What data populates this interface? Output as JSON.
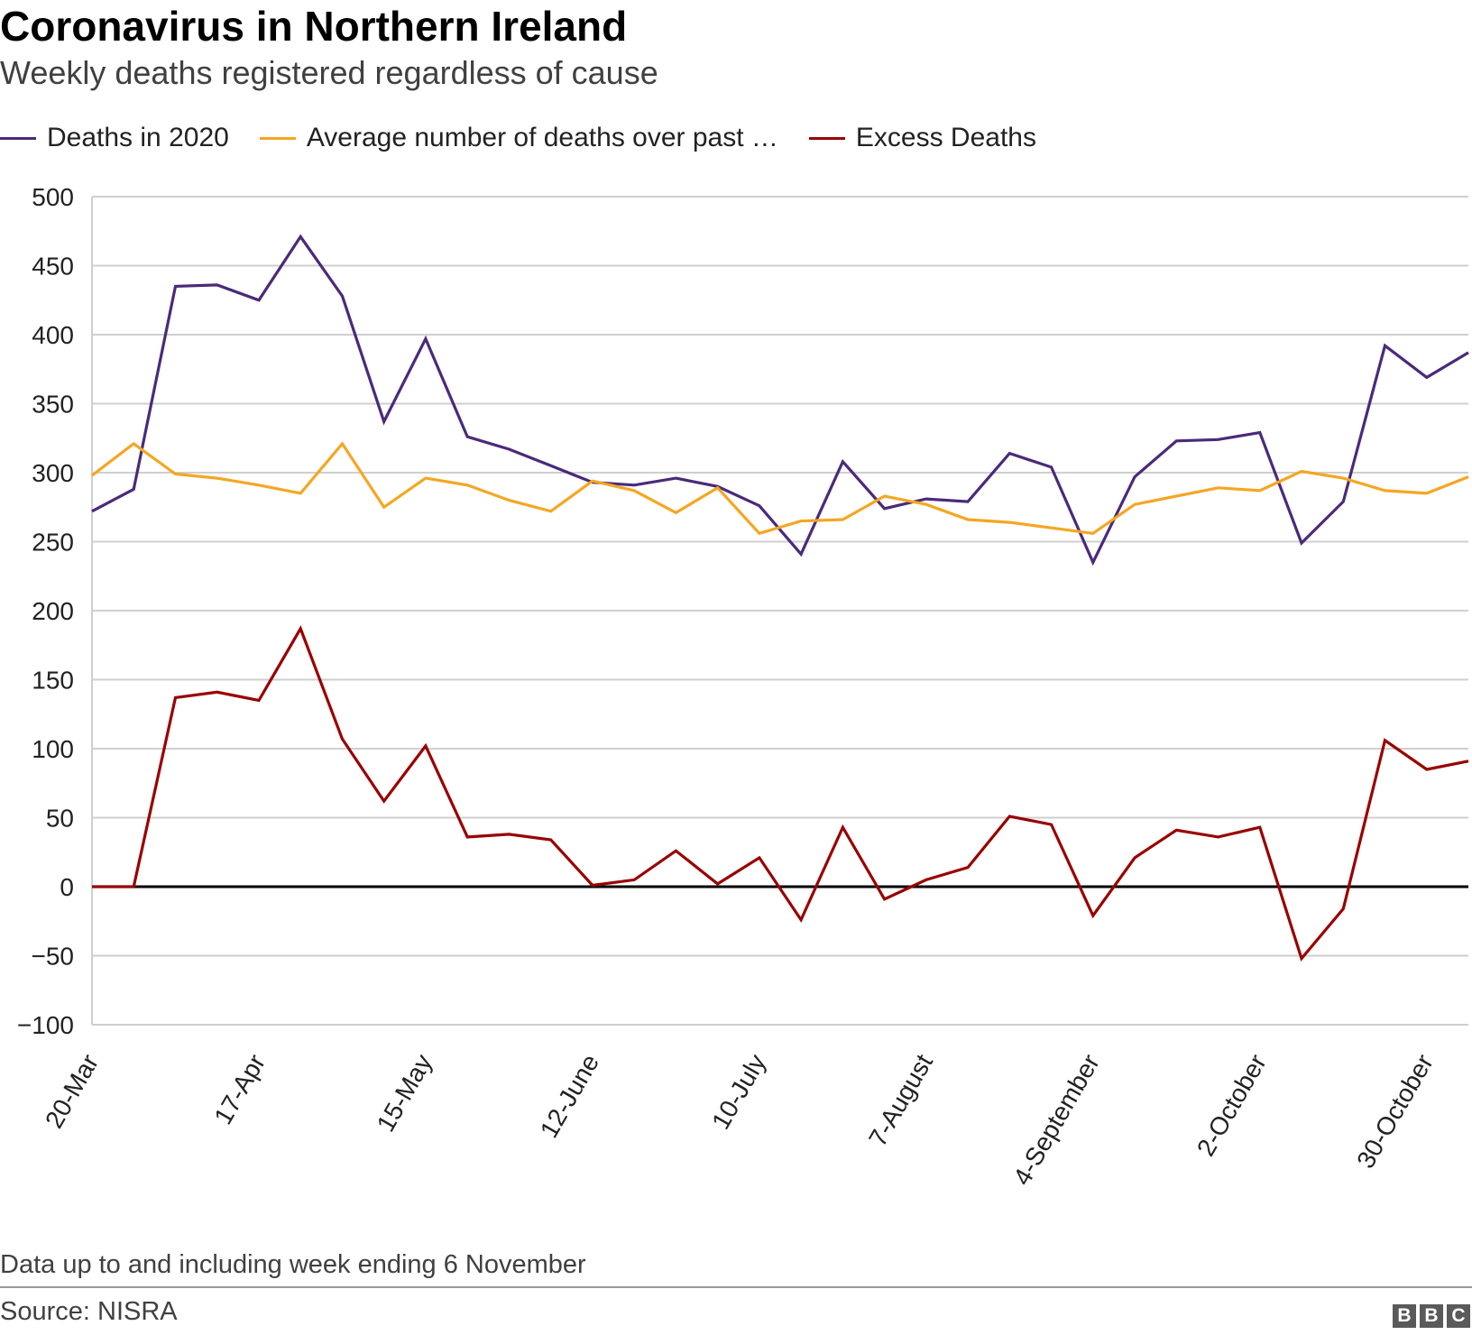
{
  "header": {
    "title": "Coronavirus in Northern Ireland",
    "subtitle": "Weekly deaths registered regardless of cause"
  },
  "footer": {
    "note": "Data up to and including week ending 6 November",
    "source": "Source: NISRA",
    "logo_text": "BBC"
  },
  "chart_data": {
    "type": "line",
    "title": "Coronavirus in Northern Ireland",
    "subtitle": "Weekly deaths registered regardless of cause",
    "xlabel": "",
    "ylabel": "",
    "ylim": [
      -100,
      500
    ],
    "yticks": [
      500,
      450,
      400,
      350,
      300,
      250,
      200,
      150,
      100,
      50,
      0,
      -50,
      -100
    ],
    "ytick_labels": [
      "500",
      "450",
      "400",
      "350",
      "300",
      "250",
      "200",
      "150",
      "100",
      "50",
      "0",
      "−50",
      "−100"
    ],
    "xtick_labels": [
      "20-Mar",
      "17-Apr",
      "15-May",
      "12-June",
      "10-July",
      "7-August",
      "4-September",
      "2-October",
      "30-October"
    ],
    "xtick_every": 4,
    "n_weeks": 34,
    "grid": true,
    "legend_position": "top",
    "series": [
      {
        "name": "Deaths in 2020",
        "color": "#4a2a7a",
        "values": [
          272,
          288,
          435,
          436,
          425,
          471,
          428,
          337,
          397,
          326,
          317,
          305,
          293,
          291,
          296,
          290,
          276,
          241,
          308,
          274,
          281,
          279,
          314,
          304,
          235,
          297,
          323,
          324,
          329,
          249,
          279,
          392,
          369,
          387
        ]
      },
      {
        "name": "Average number of deaths over past …",
        "color": "#f5a623",
        "values": [
          298,
          321,
          299,
          296,
          291,
          285,
          321,
          275,
          296,
          291,
          280,
          272,
          294,
          287,
          271,
          289,
          256,
          265,
          266,
          283,
          277,
          266,
          264,
          260,
          256,
          277,
          283,
          289,
          287,
          301,
          296,
          287,
          285,
          297
        ]
      },
      {
        "name": "Excess Deaths",
        "color": "#990000",
        "values": [
          0,
          0,
          137,
          141,
          135,
          187,
          107,
          62,
          102,
          36,
          38,
          34,
          1,
          5,
          26,
          2,
          21,
          -24,
          43,
          -9,
          5,
          14,
          51,
          45,
          -21,
          21,
          41,
          36,
          43,
          -52,
          -16,
          106,
          85,
          91
        ]
      }
    ]
  }
}
